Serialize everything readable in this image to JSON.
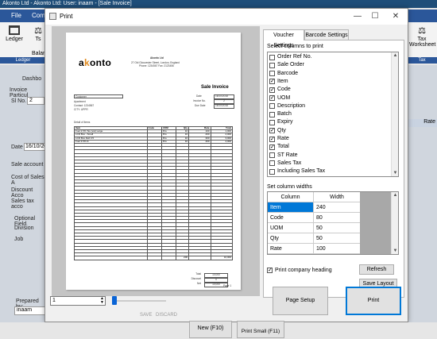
{
  "app": {
    "title": "Akonto Ltd - Akonto Ltd: User: inaam - [Sale Invoice]",
    "menus": [
      "File",
      "Com"
    ],
    "ribbon": {
      "ledger_label": "Ledger",
      "ts_label": "Ts",
      "balance_label": "Balan",
      "ledger_group": "Ledger",
      "tax_label": "Tax",
      "worksheet_label": "Worksheet",
      "tax_group": "Tax"
    },
    "left": {
      "dashboard": "Dashbo",
      "invoice_particulars": "Invoice Particul",
      "sr_no_label": "Sl No.",
      "sr_no_value": "2",
      "date_label": "Date",
      "date_value": "16/10/20",
      "sale_account": "Sale account",
      "cost_sales": "Cost of Sales A",
      "discount": "Discount Acco",
      "sales_tax": "Sales tax acco",
      "optional_fields": "Optional Field",
      "division": "Division",
      "job": "Job",
      "prepared_by": "Prepared by:",
      "prepared_value": "inaam"
    },
    "right_rate": "Rate",
    "bottom": {
      "new_btn": "New (F10)",
      "print_small_btn": "Print Small (F11)",
      "small_text": "SAVE",
      "small_text2": "DISCARD"
    }
  },
  "dialog": {
    "title": "Print",
    "controls": {
      "minimize": "—",
      "maximize": "☐",
      "close": "✕"
    },
    "preview": {
      "company_name": "Akonto Ltd",
      "company_address": "27 Old Gloucester Street, London, England",
      "company_phone": "Phone: 1234567 Fax: 2123456",
      "logo_text": "akonto",
      "doc_title": "Sale Invoice",
      "customer_label": "Customer",
      "customer_lines": [
        "Apartment",
        "Contact: 1234567",
        "CITY: UPPR"
      ],
      "meta": [
        {
          "label": "Date",
          "value": "16/10/2018"
        },
        {
          "label": "Invoice No.",
          "value": "2"
        },
        {
          "label": "Due Date",
          "value": "16/10/2018"
        }
      ],
      "items_caption": "Detail of Items",
      "headers": [
        "Item",
        "Code",
        "UOM",
        "Qty",
        "Rate",
        "Total"
      ],
      "rows": [
        [
          "Fuel 2.5% Tax (vat) Large",
          "",
          "Pcs",
          "10",
          "100",
          "1,000"
        ],
        [
          "LCD Box - Small",
          "",
          "Pcs",
          "10",
          "200",
          "2,000"
        ],
        [
          "LCD Box Dell 3.5",
          "",
          "Pcs",
          "10",
          "300",
          "3,000"
        ],
        [
          "Fuel 3.5% lit",
          "",
          "Pcs",
          "10",
          "400",
          "4,000"
        ]
      ],
      "qty_total": "200",
      "grand_total": "10,000",
      "summary": [
        {
          "label": "Total",
          "value": "10,000"
        },
        {
          "label": "Discount",
          "value": "0"
        },
        {
          "label": "Net",
          "value": "10,000"
        }
      ],
      "page_label": "Page 1"
    },
    "tabs": [
      "Voucher Settings",
      "Barcode Settings"
    ],
    "select_columns_label": "Select columns to print",
    "columns": [
      {
        "label": "Order Ref No.",
        "checked": false
      },
      {
        "label": "Sale Order",
        "checked": false
      },
      {
        "label": "Barcode",
        "checked": false
      },
      {
        "label": "Item",
        "checked": true
      },
      {
        "label": "Code",
        "checked": true
      },
      {
        "label": "UOM",
        "checked": true
      },
      {
        "label": "Description",
        "checked": false
      },
      {
        "label": "Batch",
        "checked": false
      },
      {
        "label": "Expiry",
        "checked": false
      },
      {
        "label": "Qty",
        "checked": true
      },
      {
        "label": "Rate",
        "checked": true
      },
      {
        "label": "Total",
        "checked": true
      },
      {
        "label": "ST Rate",
        "checked": false
      },
      {
        "label": "Sales Tax",
        "checked": false
      },
      {
        "label": "Including Sales Tax",
        "checked": false
      }
    ],
    "widths_label": "Set column widths",
    "widths_headers": [
      "Column",
      "Width"
    ],
    "widths": [
      {
        "column": "Item",
        "width": "240"
      },
      {
        "column": "Code",
        "width": "80"
      },
      {
        "column": "UOM",
        "width": "50"
      },
      {
        "column": "Qty",
        "width": "50"
      },
      {
        "column": "Rate",
        "width": "100"
      }
    ],
    "print_heading_label": "Print company heading",
    "print_heading_checked": true,
    "refresh_btn": "Refresh",
    "save_layout_btn": "Save Layout",
    "page_setup_btn": "Page Setup",
    "print_btn": "Print",
    "page_spin_value": "1",
    "colors": {
      "accent": "#0078d7",
      "selected_row": "#0078d7",
      "titlebar": "#2b579a"
    }
  }
}
